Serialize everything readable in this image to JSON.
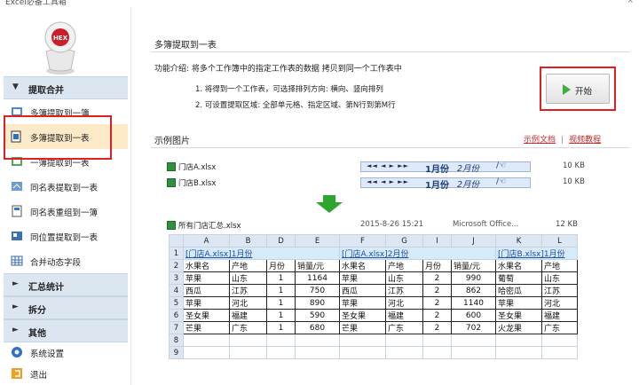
{
  "window": {
    "title": "Excel必备工具箱",
    "close_glyph": "×"
  },
  "sidebar": {
    "sections": [
      {
        "label": "提取合并",
        "arrow": "▼"
      },
      {
        "label": "汇总统计",
        "arrow": "►"
      },
      {
        "label": "拆分",
        "arrow": "►"
      },
      {
        "label": "其他",
        "arrow": "►"
      }
    ],
    "items": [
      {
        "label": "多簿提取到一簿",
        "icon": "workbook-icon"
      },
      {
        "label": "多簿提取到一表",
        "icon": "sheet-extract-icon"
      },
      {
        "label": "一簿提取到一表",
        "icon": "book-to-sheet-icon"
      },
      {
        "label": "同名表提取到一表",
        "icon": "same-name-icon"
      },
      {
        "label": "同名表重组到一簿",
        "icon": "regroup-icon"
      },
      {
        "label": "同位置提取到一表",
        "icon": "position-icon"
      },
      {
        "label": "合并动态字段",
        "icon": "table-grid-icon"
      },
      {
        "label": "系统设置",
        "icon": "settings-icon"
      },
      {
        "label": "退出",
        "icon": "exit-icon"
      }
    ],
    "selected": "多簿提取到一表"
  },
  "main": {
    "title": "多簿提取到一表",
    "description": "功能介绍: 将多个工作簿中的指定工作表的数据 拷贝到同一个工作表中",
    "points": [
      "1. 将得到一个工作表，可选择排列方向: 横向、竖向排列",
      "2. 可设置提取区域: 全部单元格、指定区域、第N行到第M行"
    ],
    "start_label": "开始",
    "example_title": "示例图片",
    "link_doc": "示例文档",
    "link_sep": "|",
    "link_video": "视频教程"
  },
  "example": {
    "files": [
      {
        "name": "门店A.xlsx",
        "tab_nav": "◄◄ ◄ ► ►►",
        "tab_active": "1月份",
        "tab_next": "2月份",
        "tab_more": "/☜",
        "size": "10 KB"
      },
      {
        "name": "门店B.xlsx",
        "tab_nav": "◄◄ ◄ ► ►►",
        "tab_active": "1月份",
        "tab_next": "2月份",
        "tab_more": "/☜",
        "size": "10 KB"
      }
    ],
    "summary": {
      "name": "所有门店汇总.xlsx",
      "date": "2015-8-26 15:21",
      "app": "Microsoft Office...",
      "size": "12 KB"
    },
    "sheet": {
      "columns": [
        "A",
        "B",
        "D",
        "E",
        "F",
        "G",
        "I",
        "J",
        "K",
        "L"
      ],
      "row_numbers": [
        "1",
        "2",
        "3",
        "4",
        "5",
        "6",
        "7",
        "8",
        "9"
      ],
      "group_titles": [
        "[门店A.xlsx]1月份",
        "[门店A.xlsx]2月份",
        "[门店B.xlsx]1月份"
      ],
      "headers": [
        "水果名",
        "产地",
        "月份",
        "销量/元",
        "水果名",
        "产地",
        "月份",
        "销量/元",
        "水果名",
        "产地"
      ],
      "rows": [
        [
          "苹果",
          "山东",
          "1",
          "1164",
          "苹果",
          "山东",
          "2",
          "990",
          "葡萄",
          "山东"
        ],
        [
          "西瓜",
          "江苏",
          "1",
          "750",
          "西瓜",
          "江苏",
          "2",
          "862",
          "哈密瓜",
          "江苏"
        ],
        [
          "苹果",
          "河北",
          "1",
          "890",
          "苹果",
          "河北",
          "2",
          "1140",
          "苹果",
          "河北"
        ],
        [
          "圣女果",
          "福建",
          "1",
          "590",
          "圣女果",
          "福建",
          "2",
          "600",
          "圣女果",
          "福建"
        ],
        [
          "芒果",
          "广东",
          "1",
          "680",
          "芒果",
          "广东",
          "2",
          "702",
          "火龙果",
          "广东"
        ]
      ]
    }
  }
}
